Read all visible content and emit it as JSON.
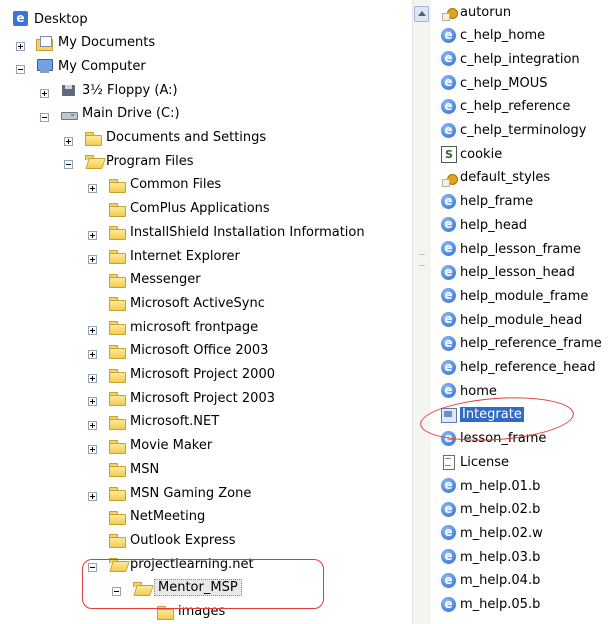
{
  "tree": [
    {
      "label": "Desktop",
      "icon": "desktop-icon",
      "depth": 0,
      "toggle": "none"
    },
    {
      "label": "My Documents",
      "icon": "my-documents-icon",
      "depth": 1,
      "toggle": "plus"
    },
    {
      "label": "My Computer",
      "icon": "my-computer-icon",
      "depth": 1,
      "toggle": "minus"
    },
    {
      "label": "3½ Floppy (A:)",
      "icon": "floppy-drive-icon",
      "depth": 2,
      "toggle": "plus"
    },
    {
      "label": "Main Drive (C:)",
      "icon": "hard-drive-icon",
      "depth": 2,
      "toggle": "minus"
    },
    {
      "label": "Documents and Settings",
      "icon": "folder-icon",
      "depth": 3,
      "toggle": "plus"
    },
    {
      "label": "Program Files",
      "icon": "open-folder-icon",
      "depth": 3,
      "toggle": "minus"
    },
    {
      "label": "Common Files",
      "icon": "folder-icon",
      "depth": 4,
      "toggle": "plus"
    },
    {
      "label": "ComPlus Applications",
      "icon": "folder-icon",
      "depth": 4,
      "toggle": "none"
    },
    {
      "label": "InstallShield Installation Information",
      "icon": "folder-icon",
      "depth": 4,
      "toggle": "plus"
    },
    {
      "label": "Internet Explorer",
      "icon": "folder-icon",
      "depth": 4,
      "toggle": "plus"
    },
    {
      "label": "Messenger",
      "icon": "folder-icon",
      "depth": 4,
      "toggle": "none"
    },
    {
      "label": "Microsoft ActiveSync",
      "icon": "folder-icon",
      "depth": 4,
      "toggle": "none"
    },
    {
      "label": "microsoft frontpage",
      "icon": "folder-icon",
      "depth": 4,
      "toggle": "plus"
    },
    {
      "label": "Microsoft Office 2003",
      "icon": "folder-icon",
      "depth": 4,
      "toggle": "plus"
    },
    {
      "label": "Microsoft Project 2000",
      "icon": "folder-icon",
      "depth": 4,
      "toggle": "plus"
    },
    {
      "label": "Microsoft Project 2003",
      "icon": "folder-icon",
      "depth": 4,
      "toggle": "plus"
    },
    {
      "label": "Microsoft.NET",
      "icon": "folder-icon",
      "depth": 4,
      "toggle": "plus"
    },
    {
      "label": "Movie Maker",
      "icon": "folder-icon",
      "depth": 4,
      "toggle": "plus"
    },
    {
      "label": "MSN",
      "icon": "folder-icon",
      "depth": 4,
      "toggle": "none"
    },
    {
      "label": "MSN Gaming Zone",
      "icon": "folder-icon",
      "depth": 4,
      "toggle": "plus"
    },
    {
      "label": "NetMeeting",
      "icon": "folder-icon",
      "depth": 4,
      "toggle": "none"
    },
    {
      "label": "Outlook Express",
      "icon": "folder-icon",
      "depth": 4,
      "toggle": "none"
    },
    {
      "label": "projectlearning.net",
      "icon": "open-folder-icon",
      "depth": 4,
      "toggle": "minus"
    },
    {
      "label": "Mentor_MSP",
      "icon": "open-folder-icon",
      "depth": 5,
      "toggle": "minus",
      "selected": true
    },
    {
      "label": "images",
      "icon": "folder-icon",
      "depth": 6,
      "toggle": "none"
    }
  ],
  "files": [
    {
      "label": "autorun",
      "icon": "setup-info-icon"
    },
    {
      "label": "c_help_home",
      "icon": "ie-document-icon"
    },
    {
      "label": "c_help_integration",
      "icon": "ie-document-icon"
    },
    {
      "label": "c_help_MOUS",
      "icon": "ie-document-icon"
    },
    {
      "label": "c_help_reference",
      "icon": "ie-document-icon"
    },
    {
      "label": "c_help_terminology",
      "icon": "ie-document-icon"
    },
    {
      "label": "cookie",
      "icon": "script-file-icon"
    },
    {
      "label": "default_styles",
      "icon": "setup-info-icon"
    },
    {
      "label": "help_frame",
      "icon": "ie-document-icon"
    },
    {
      "label": "help_head",
      "icon": "ie-document-icon"
    },
    {
      "label": "help_lesson_frame",
      "icon": "ie-document-icon"
    },
    {
      "label": "help_lesson_head",
      "icon": "ie-document-icon"
    },
    {
      "label": "help_module_frame",
      "icon": "ie-document-icon"
    },
    {
      "label": "help_module_head",
      "icon": "ie-document-icon"
    },
    {
      "label": "help_reference_frame",
      "icon": "ie-document-icon"
    },
    {
      "label": "help_reference_head",
      "icon": "ie-document-icon"
    },
    {
      "label": "home",
      "icon": "ie-document-icon"
    },
    {
      "label": "Integrate",
      "icon": "application-icon",
      "selected": true
    },
    {
      "label": "lesson_frame",
      "icon": "ie-document-icon"
    },
    {
      "label": "License",
      "icon": "text-document-icon"
    },
    {
      "label": "m_help.01.b",
      "icon": "ie-document-icon"
    },
    {
      "label": "m_help.02.b",
      "icon": "ie-document-icon"
    },
    {
      "label": "m_help.02.w",
      "icon": "ie-document-icon"
    },
    {
      "label": "m_help.03.b",
      "icon": "ie-document-icon"
    },
    {
      "label": "m_help.04.b",
      "icon": "ie-document-icon"
    },
    {
      "label": "m_help.05.b",
      "icon": "ie-document-icon"
    }
  ],
  "colors": {
    "selection": "#316ac5",
    "callout": "#e23b3b",
    "folder": "#f1cc55"
  }
}
